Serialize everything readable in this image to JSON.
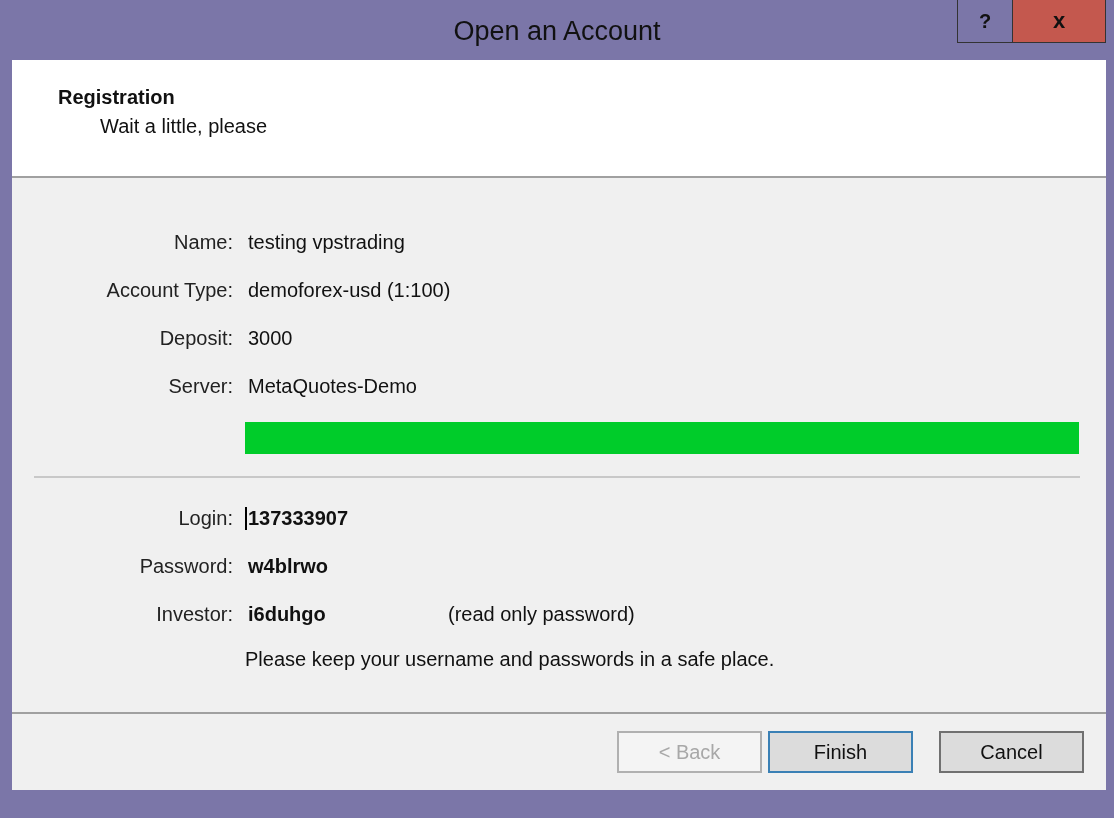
{
  "window": {
    "title": "Open an Account",
    "help": "?",
    "close": "x"
  },
  "header": {
    "title": "Registration",
    "subtitle": "Wait a little, please"
  },
  "details": [
    {
      "label": "Name:",
      "value": "testing vpstrading"
    },
    {
      "label": "Account Type:",
      "value": "demoforex-usd (1:100)"
    },
    {
      "label": "Deposit:",
      "value": "3000"
    },
    {
      "label": "Server:",
      "value": "MetaQuotes-Demo"
    }
  ],
  "progress": {
    "level": 1
  },
  "credentials": [
    {
      "label": "Login:",
      "value": "137333907",
      "focused": true
    },
    {
      "label": "Password:",
      "value": "w4blrwo",
      "focused": false
    },
    {
      "label": "Investor:",
      "value": "i6duhgo",
      "focused": false,
      "note": "(read only password)"
    }
  ],
  "notice": "Please keep your username and passwords in a safe place.",
  "buttons": [
    {
      "label": "< Back",
      "disabled": true,
      "default": false
    },
    {
      "label": "Finish",
      "disabled": false,
      "default": true
    },
    {
      "label": "Cancel",
      "disabled": false,
      "default": false
    }
  ]
}
